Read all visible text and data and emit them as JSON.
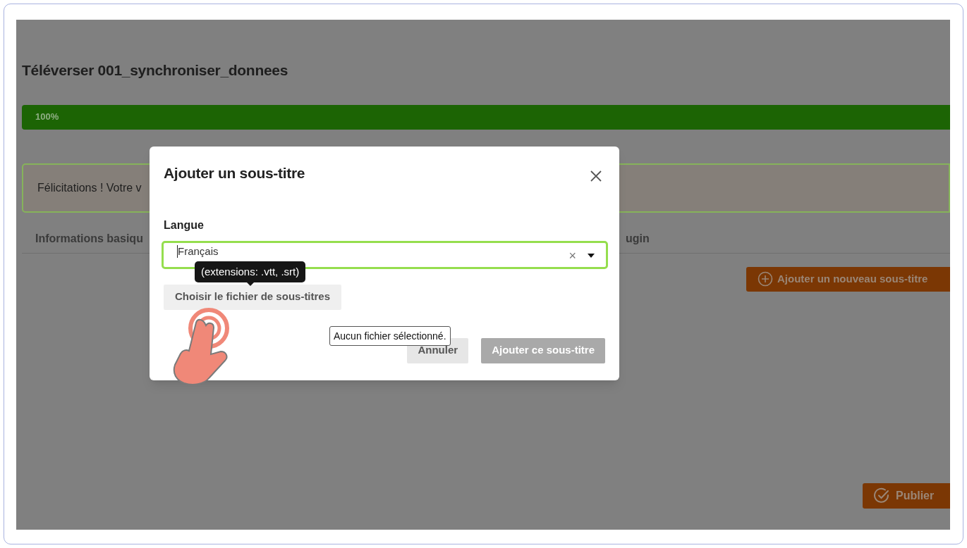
{
  "page": {
    "title": "Téléverser 001_synchroniser_donnees",
    "progress": {
      "label": "100%",
      "level": 1
    },
    "alert": "Félicitations ! Votre v",
    "tabs": [
      {
        "label": "Informations basiqu"
      },
      {
        "label": "ugin"
      }
    ],
    "add_button": "Ajouter un nouveau sous-titre",
    "publish_button": "Publier"
  },
  "dialog": {
    "title": "Ajouter un sous-titre",
    "field_label": "Langue",
    "field_value": "Français",
    "clear": "×",
    "tooltip": "(extensions: .vtt, .srt)",
    "file_button": "Choisir le fichier de sous-titres",
    "file_hint": "Aucun fichier sélectionné.",
    "buttons": [
      {
        "label": "Annuler",
        "disabled": false
      },
      {
        "label": "Ajouter ce sous-titre",
        "disabled": true
      }
    ]
  }
}
